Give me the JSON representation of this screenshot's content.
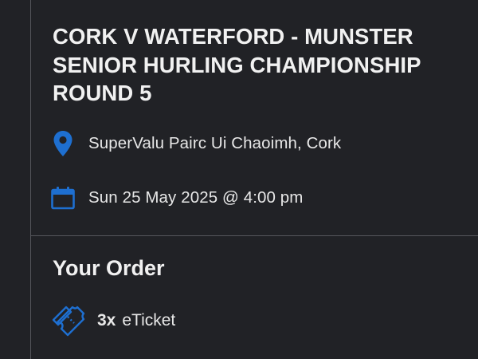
{
  "event": {
    "title": "CORK V WATERFORD - MUNSTER SENIOR HURLING CHAMPIONSHIP ROUND 5",
    "venue": "SuperValu Pairc Ui Chaoimh, Cork",
    "datetime": "Sun 25 May 2025 @ 4:00 pm",
    "venue_icon": "location-pin-icon",
    "date_icon": "calendar-icon"
  },
  "order": {
    "heading": "Your Order",
    "quantity": "3x",
    "item": "eTicket",
    "item_icon": "ticket-icon"
  },
  "colors": {
    "background": "#212226",
    "accent": "#1e6fd0",
    "text": "#f1f1f1",
    "divider": "#55565b"
  }
}
